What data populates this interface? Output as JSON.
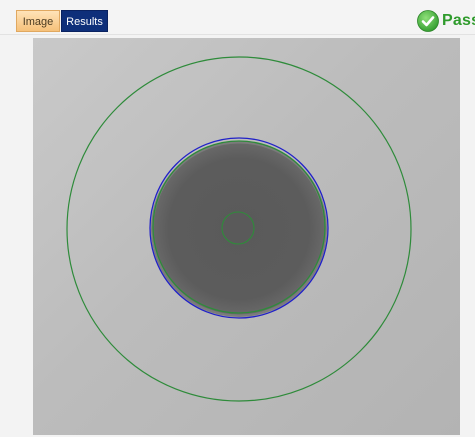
{
  "tabs": [
    {
      "label": "Image",
      "active": true
    },
    {
      "label": "Results",
      "active": false
    }
  ],
  "status": {
    "text": "Pass",
    "icon": "check-circle-icon",
    "color": "#2f9b2c"
  },
  "colors": {
    "cladding_ring": "#2e8b3a",
    "core_boundary": "#2020c8",
    "ferrule_dark": "#5e5e5e",
    "image_background": "#c0c0c0"
  }
}
